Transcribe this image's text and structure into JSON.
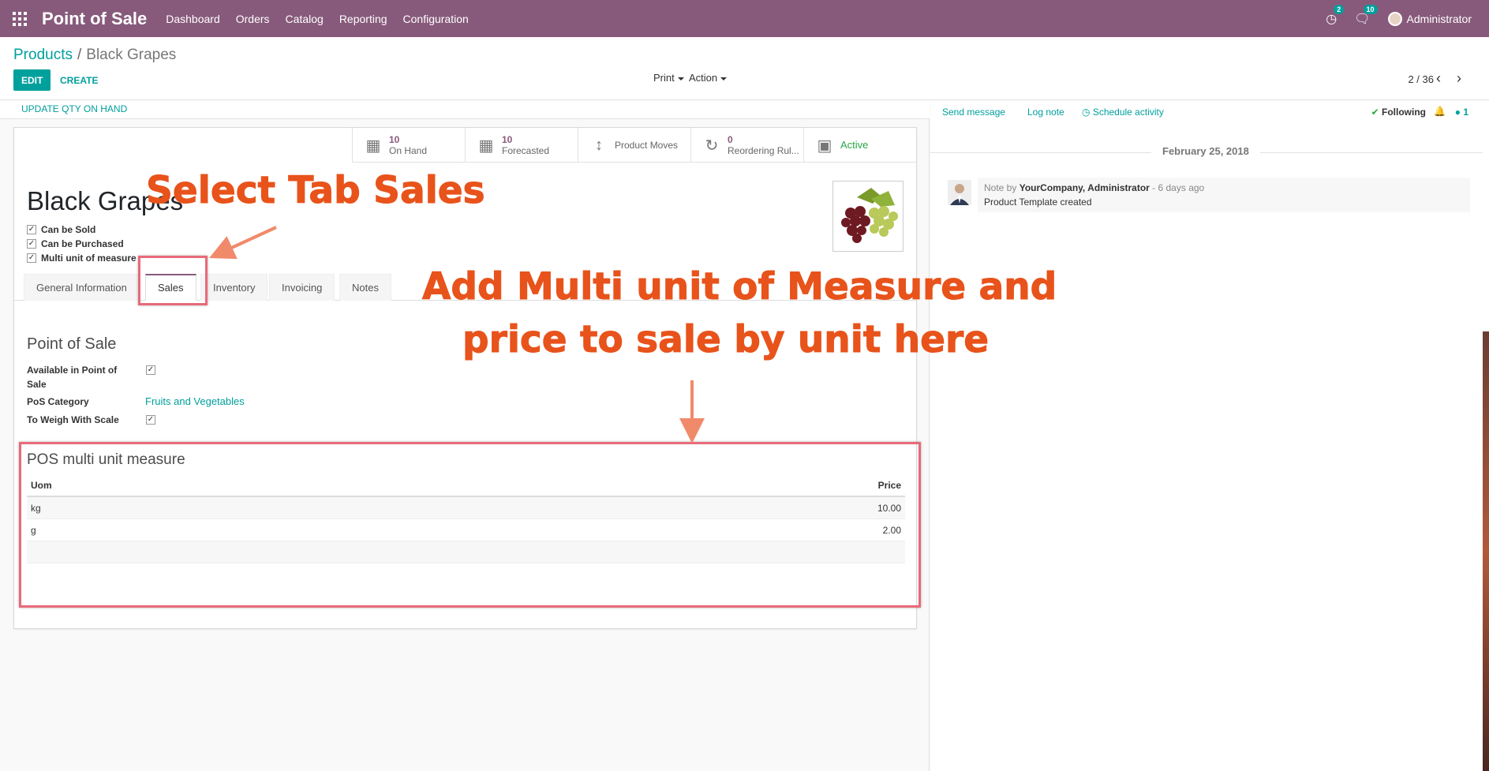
{
  "navbar": {
    "brand": "Point of Sale",
    "menu": [
      "Dashboard",
      "Orders",
      "Catalog",
      "Reporting",
      "Configuration"
    ],
    "activity_badge": "2",
    "messages_badge": "10",
    "user": "Administrator"
  },
  "control_panel": {
    "breadcrumb_parent": "Products",
    "breadcrumb_separator": "/",
    "breadcrumb_current": "Black Grapes",
    "edit_label": "EDIT",
    "create_label": "CREATE",
    "print_label": "Print",
    "action_label": "Action",
    "pager": "2 / 36"
  },
  "form": {
    "update_qty_label": "UPDATE QTY ON HAND",
    "smart_buttons": [
      {
        "icon": "building-icon",
        "value": "10",
        "label": "On Hand"
      },
      {
        "icon": "building-icon",
        "value": "10",
        "label": "Forecasted"
      },
      {
        "icon": "arrows-vertical-icon",
        "value": "",
        "label": "Product Moves"
      },
      {
        "icon": "refresh-icon",
        "value": "0",
        "label": "Reordering Rul..."
      },
      {
        "icon": "archive-icon",
        "value": "",
        "label": "Active"
      }
    ],
    "product_name": "Black Grapes",
    "checkboxes": [
      "Can be Sold",
      "Can be Purchased",
      "Multi unit of measure"
    ],
    "tabs": [
      "General Information",
      "Sales",
      "Inventory",
      "Invoicing",
      "Notes"
    ],
    "active_tab": "Sales",
    "pos_section_title": "Point of Sale",
    "fields": {
      "available_label": "Available in Point of Sale",
      "pos_category_label": "PoS Category",
      "pos_category_value": "Fruits and Vegetables",
      "to_weigh_label": "To Weigh With Scale"
    },
    "multi_uom": {
      "title": "POS multi unit measure",
      "headers": [
        "Uom",
        "Price"
      ],
      "rows": [
        {
          "uom": "kg",
          "price": "10.00"
        },
        {
          "uom": "g",
          "price": "2.00"
        }
      ]
    }
  },
  "chatter": {
    "send_message": "Send message",
    "log_note": "Log note",
    "schedule_activity": "Schedule activity",
    "following": "Following",
    "followers": "1",
    "date": "February 25, 2018",
    "note_prefix": "Note by",
    "note_author": "YourCompany, Administrator",
    "note_time": "- 6 days ago",
    "note_body": "Product Template created"
  },
  "annotations": {
    "select_tab": "Select Tab Sales",
    "add_multi_line1": "Add Multi unit of Measure and",
    "add_multi_line2": "price to sale by unit here",
    "color": "#e8531b"
  }
}
